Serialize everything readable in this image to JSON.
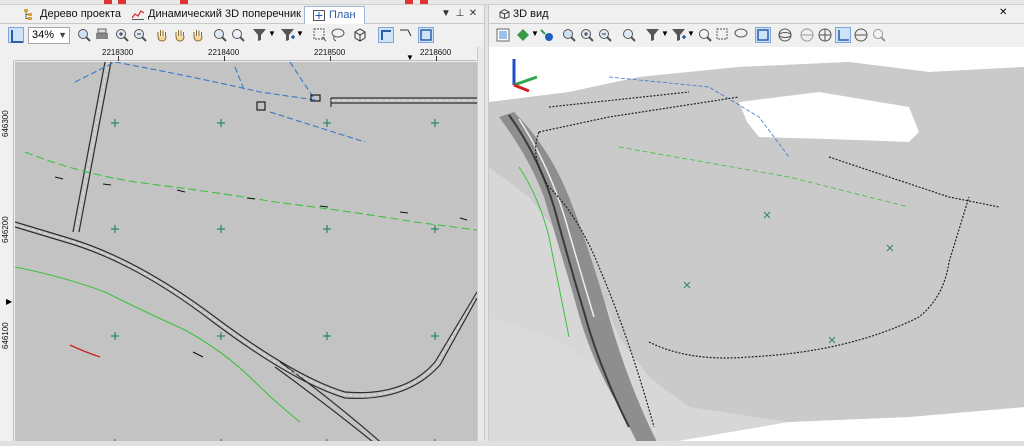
{
  "left_pane": {
    "tabs": [
      {
        "label": "Дерево проекта",
        "icon": "tree-icon",
        "active": false
      },
      {
        "label": "Динамический 3D поперечник",
        "icon": "cross-section-icon",
        "active": false
      },
      {
        "label": "План",
        "icon": "plan-icon",
        "active": true
      }
    ],
    "tab_controls": {
      "menu": "▼",
      "pin": "⊥",
      "close": "✕"
    },
    "toolbar": {
      "zoom_value": "34%",
      "zoom_arrow": "▼"
    },
    "ruler_top": [
      "2218300",
      "2218400",
      "2218500",
      "2218600"
    ],
    "ruler_left": [
      "646300",
      "646200",
      "646100"
    ]
  },
  "right_pane": {
    "title": "3D вид",
    "title_icon": "3d-view-icon",
    "close": "✕"
  },
  "colors": {
    "map_bg": "#c3c3c3",
    "road": "#2e2e2e",
    "green_line": "#3cc23c",
    "blue_line": "#3a78c8",
    "grid_cross": "#2a8a5a",
    "accent": "#2a5ea8"
  }
}
